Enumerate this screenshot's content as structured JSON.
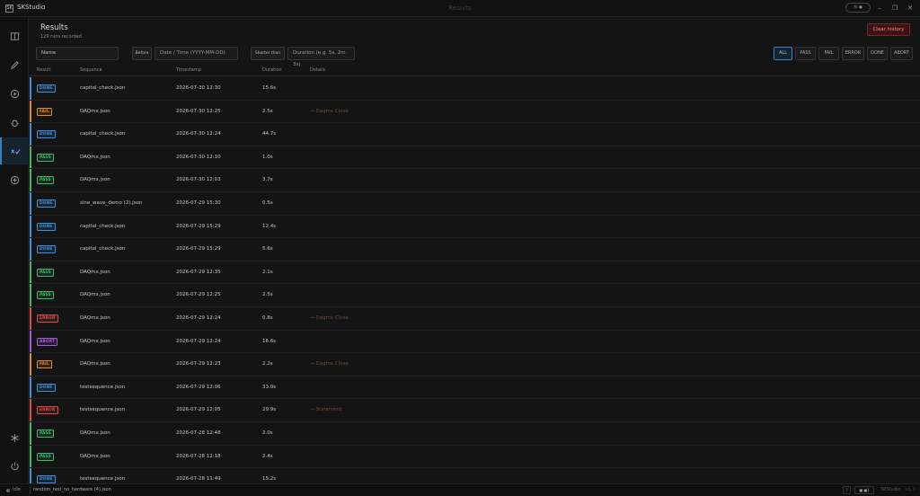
{
  "app": {
    "name": "SKStudio",
    "window_title": "Results",
    "ai_label": "AI ●",
    "logo_text": "SK"
  },
  "window_controls": {
    "minimize": "–",
    "restore": "❐",
    "close": "✕"
  },
  "sidebar": {
    "items": [
      {
        "icon": "book-icon"
      },
      {
        "icon": "pencil-icon"
      },
      {
        "icon": "play-icon"
      },
      {
        "icon": "bug-icon"
      },
      {
        "icon": "results-icon"
      },
      {
        "icon": "plus-circle-icon"
      },
      {
        "icon": "snowflake-icon"
      },
      {
        "icon": "power-icon"
      }
    ]
  },
  "header": {
    "title": "Results",
    "subtitle": "129 runs recorded",
    "clear_label": "Clear history"
  },
  "filters": {
    "name_placeholder": "Name",
    "before_label": "Before",
    "date_placeholder": "Date / Time  (YYYY-MM-DD)",
    "shorter_label": "Shorter than",
    "duration_placeholder": "Duration  (e.g. 5s, 2m 3s)",
    "status_buttons": [
      "ALL",
      "PASS",
      "FAIL",
      "ERROR",
      "DONE",
      "ABORT"
    ],
    "active_status": "ALL"
  },
  "table": {
    "columns": [
      "Result",
      "Sequence",
      "Timestamp",
      "Duration",
      "Details"
    ],
    "rows": [
      {
        "result": "DONE",
        "sequence": "capital_check.json",
        "timestamp": "2026-07-30  12:30",
        "duration": "15.6s",
        "details": ""
      },
      {
        "result": "FAIL",
        "sequence": "DAQmx.json",
        "timestamp": "2026-07-30  12:25",
        "duration": "2.5s",
        "details": "→ Daqmx Close"
      },
      {
        "result": "DONE",
        "sequence": "capital_check.json",
        "timestamp": "2026-07-30  12:24",
        "duration": "44.7s",
        "details": ""
      },
      {
        "result": "PASS",
        "sequence": "DAQmx.json",
        "timestamp": "2026-07-30  12:10",
        "duration": "1.0s",
        "details": ""
      },
      {
        "result": "PASS",
        "sequence": "DAQmx.json",
        "timestamp": "2026-07-30  12:03",
        "duration": "3.7s",
        "details": ""
      },
      {
        "result": "DONE",
        "sequence": "sine_wave_demo (2).json",
        "timestamp": "2026-07-29  15:30",
        "duration": "0.5s",
        "details": ""
      },
      {
        "result": "DONE",
        "sequence": "capital_check.json",
        "timestamp": "2026-07-29  15:29",
        "duration": "12.4s",
        "details": ""
      },
      {
        "result": "DONE",
        "sequence": "capital_check.json",
        "timestamp": "2026-07-29  15:29",
        "duration": "5.6s",
        "details": ""
      },
      {
        "result": "PASS",
        "sequence": "DAQmx.json",
        "timestamp": "2026-07-29  12:35",
        "duration": "2.1s",
        "details": ""
      },
      {
        "result": "PASS",
        "sequence": "DAQmx.json",
        "timestamp": "2026-07-29  12:25",
        "duration": "2.5s",
        "details": ""
      },
      {
        "result": "ERROR",
        "sequence": "DAQmx.json",
        "timestamp": "2026-07-29  12:24",
        "duration": "0.8s",
        "details": "→ Daqmx Close"
      },
      {
        "result": "ABORT",
        "sequence": "DAQmx.json",
        "timestamp": "2026-07-29  12:24",
        "duration": "16.6s",
        "details": ""
      },
      {
        "result": "FAIL",
        "sequence": "DAQmx.json",
        "timestamp": "2026-07-29  12:23",
        "duration": "2.2s",
        "details": "→ Daqmx Close"
      },
      {
        "result": "DONE",
        "sequence": "testsequence.json",
        "timestamp": "2026-07-29  12:06",
        "duration": "33.0s",
        "details": ""
      },
      {
        "result": "ERROR",
        "sequence": "testsequence.json",
        "timestamp": "2026-07-29  12:05",
        "duration": "29.9s",
        "details": "→ Statement"
      },
      {
        "result": "PASS",
        "sequence": "DAQmx.json",
        "timestamp": "2026-07-28  12:48",
        "duration": "2.0s",
        "details": ""
      },
      {
        "result": "PASS",
        "sequence": "DAQmx.json",
        "timestamp": "2026-07-28  12:18",
        "duration": "2.4s",
        "details": ""
      },
      {
        "result": "DONE",
        "sequence": "testsequence.json",
        "timestamp": "2026-07-28  11:49",
        "duration": "15.2s",
        "details": ""
      }
    ]
  },
  "status_colors": {
    "DONE": "#3a8fd9",
    "PASS": "#3fb86a",
    "FAIL": "#e08a2e",
    "ERROR": "#e04848",
    "ABORT": "#a35ad6"
  },
  "statusbar": {
    "state": "Idle",
    "file": "random_test_no_hardware (4).json",
    "help": "?",
    "toggle": "■ ■1",
    "brand": "SKStudio",
    "version": "v1.0"
  }
}
